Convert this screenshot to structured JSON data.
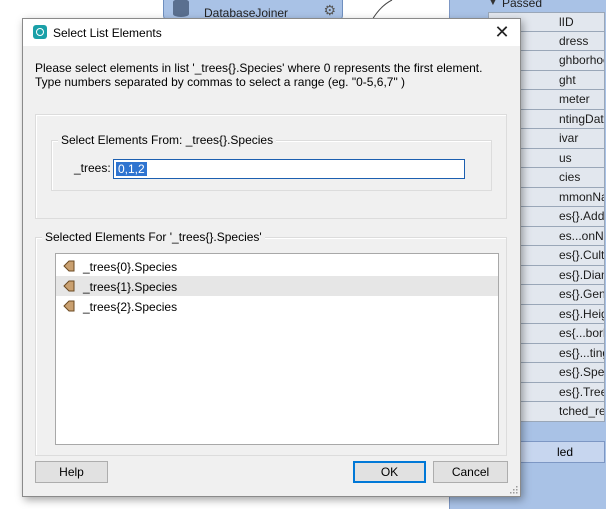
{
  "background": {
    "node_label": "DatabaseJoiner",
    "panel_header": "Passed",
    "attributes": [
      "lID",
      "dress",
      "ghborhood",
      "ght",
      "meter",
      "ntingDate",
      "ivar",
      "us",
      "cies",
      "mmonName",
      "es{}.Address",
      "es...onName",
      "es{}.Cultivar",
      "es{}.Diameter",
      "es{}.Genus",
      "es{}.Height",
      "es{...borhood",
      "es{}...tingDate",
      "es{}.Species",
      "es{}.TreeID",
      "tched_records"
    ],
    "panel_footer": "led"
  },
  "dialog": {
    "title": "Select List Elements",
    "close_glyph": "✕",
    "instruction_line1": "Please select elements in list '_trees{}.Species' where 0 represents the first element.",
    "instruction_line2": "Type numbers separated by commas to select a range (eg. \"0-5,6,7\" )",
    "select_group_legend": "Select Elements From: _trees{}.Species",
    "field_label": "_trees:",
    "field_value": "0,1,2",
    "selected_group_legend": "Selected Elements For '_trees{}.Species'",
    "selected_items": [
      "_trees{0}.Species",
      "_trees{1}.Species",
      "_trees{2}.Species"
    ],
    "buttons": {
      "help": "Help",
      "ok": "OK",
      "cancel": "Cancel"
    }
  },
  "colors": {
    "accent": "#0078d7",
    "panel_bg": "#a9c2e6",
    "selection": "#2f74d0",
    "list_arrow": "#b5895a"
  }
}
